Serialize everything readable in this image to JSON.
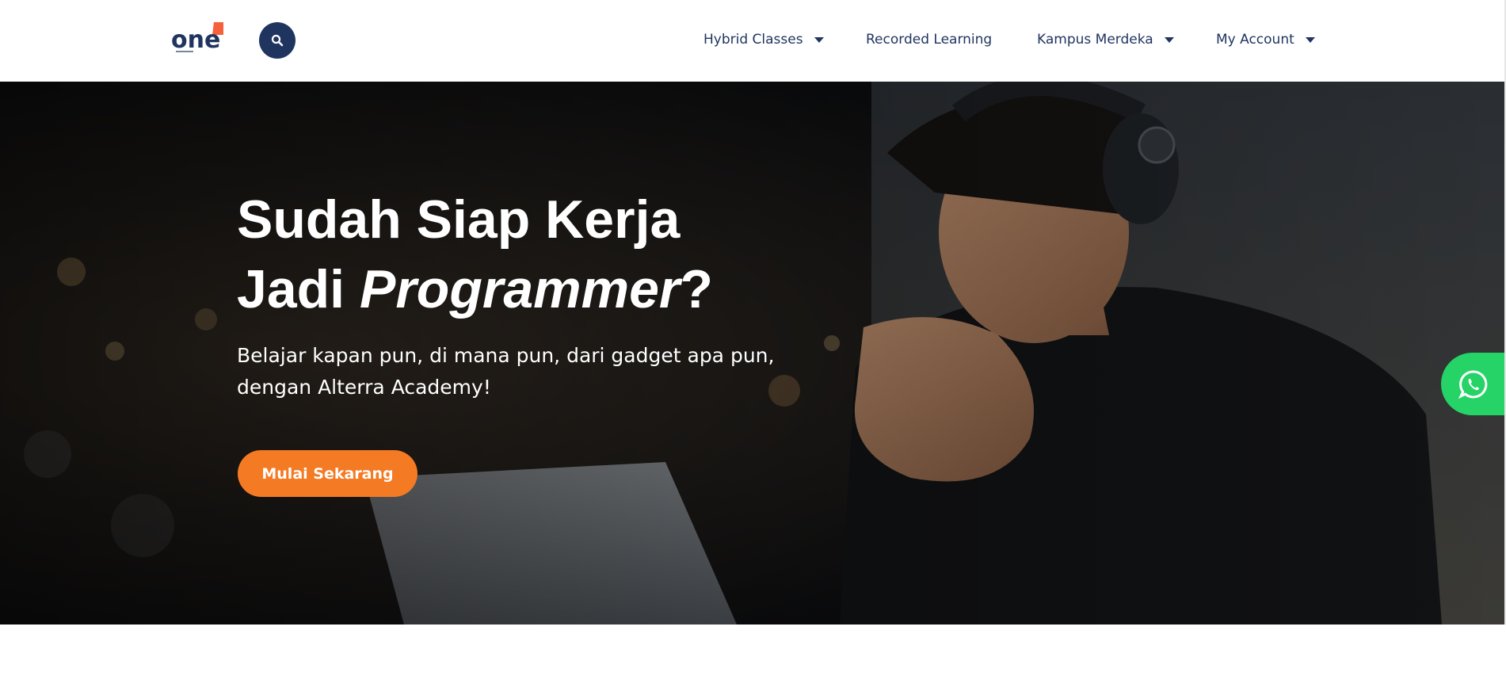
{
  "header": {
    "logo": {
      "text": "one",
      "icon": "one-alterra-logo",
      "colors": {
        "primary": "#1f3560",
        "accent": "#f4613a"
      }
    },
    "search": {
      "icon": "search-icon"
    },
    "nav": [
      {
        "label": "Hybrid Classes",
        "has_dropdown": true
      },
      {
        "label": "Recorded Learning",
        "has_dropdown": false
      },
      {
        "label": "Kampus Merdeka",
        "has_dropdown": true
      },
      {
        "label": "My Account",
        "has_dropdown": true
      }
    ]
  },
  "hero": {
    "title_line1": "Sudah Siap Kerja",
    "title_line2_prefix": "Jadi ",
    "title_line2_emphasis": "Programmer",
    "title_line2_suffix": "?",
    "subtitle_line1": "Belajar kapan pun, di mana pun, dari gadget apa pun,",
    "subtitle_line2": "dengan Alterra Academy!",
    "cta_label": "Mulai Sekarang",
    "image": "student-with-headphones-photo"
  },
  "floating": {
    "whatsapp_icon": "whatsapp-icon"
  },
  "colors": {
    "nav_text": "#1f3560",
    "search_bg": "#1f3560",
    "cta_bg": "#f47a23",
    "whatsapp_bg": "#25d366",
    "hero_text": "#ffffff"
  }
}
